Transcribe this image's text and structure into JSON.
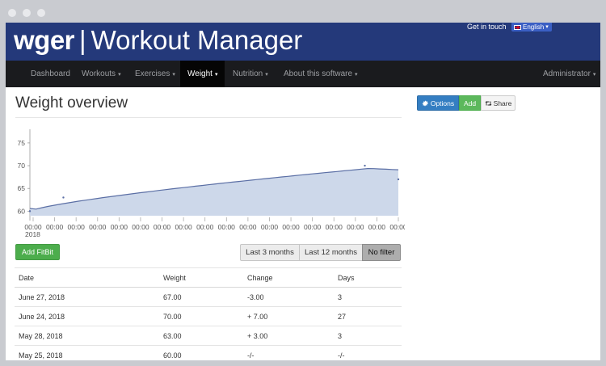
{
  "app": {
    "brand_bold": "wger",
    "brand_sep": "|",
    "brand_light": "Workout Manager",
    "contact_link": "Get in touch",
    "language": "English"
  },
  "nav": {
    "items": [
      {
        "label": "Dashboard",
        "dropdown": false
      },
      {
        "label": "Workouts",
        "dropdown": true
      },
      {
        "label": "Exercises",
        "dropdown": true
      },
      {
        "label": "Weight",
        "dropdown": true,
        "active": true
      },
      {
        "label": "Nutrition",
        "dropdown": true
      },
      {
        "label": "About this software",
        "dropdown": true
      }
    ],
    "user": "Administrator",
    "caret": "▾"
  },
  "page": {
    "title": "Weight overview"
  },
  "actions": {
    "options_label": "Options",
    "add_label": "Add",
    "share_label": "Share"
  },
  "fitbit_label": "Add FitBit",
  "filters": {
    "last3": "Last 3 months",
    "last12": "Last 12 months",
    "none": "No filter",
    "selected": "No filter"
  },
  "chart_data": {
    "type": "area",
    "y_ticks": [
      "75",
      "70",
      "65",
      "60"
    ],
    "ylim": [
      59,
      78
    ],
    "x_ticks": [
      "00:00",
      "00:00",
      "00:00",
      "00:00",
      "00:00",
      "00:00",
      "00:00",
      "00:00",
      "00:00",
      "00:00",
      "00:00",
      "00:00",
      "00:00",
      "00:00",
      "00:00",
      "00:00",
      "00:00",
      "00:00"
    ],
    "x_year": "2018",
    "series": [
      {
        "x": [
          "2018-05-25",
          "2018-05-28",
          "2018-06-24",
          "2018-06-27"
        ],
        "values": [
          60.0,
          63.0,
          70.0,
          67.0
        ]
      }
    ],
    "color": "#cdd8ea",
    "line_color": "#5b6fa5"
  },
  "table": {
    "headers": [
      "Date",
      "Weight",
      "Change",
      "Days"
    ],
    "rows": [
      [
        "June 27, 2018",
        "67.00",
        "-3.00",
        "3"
      ],
      [
        "June 24, 2018",
        "70.00",
        "+ 7.00",
        "27"
      ],
      [
        "May 28, 2018",
        "63.00",
        "+ 3.00",
        "3"
      ],
      [
        "May 25, 2018",
        "60.00",
        "-/-",
        "-/-"
      ]
    ]
  },
  "icons": {
    "options": "gear-icon",
    "share": "retweet-icon",
    "flag": "uk-flag-icon"
  }
}
